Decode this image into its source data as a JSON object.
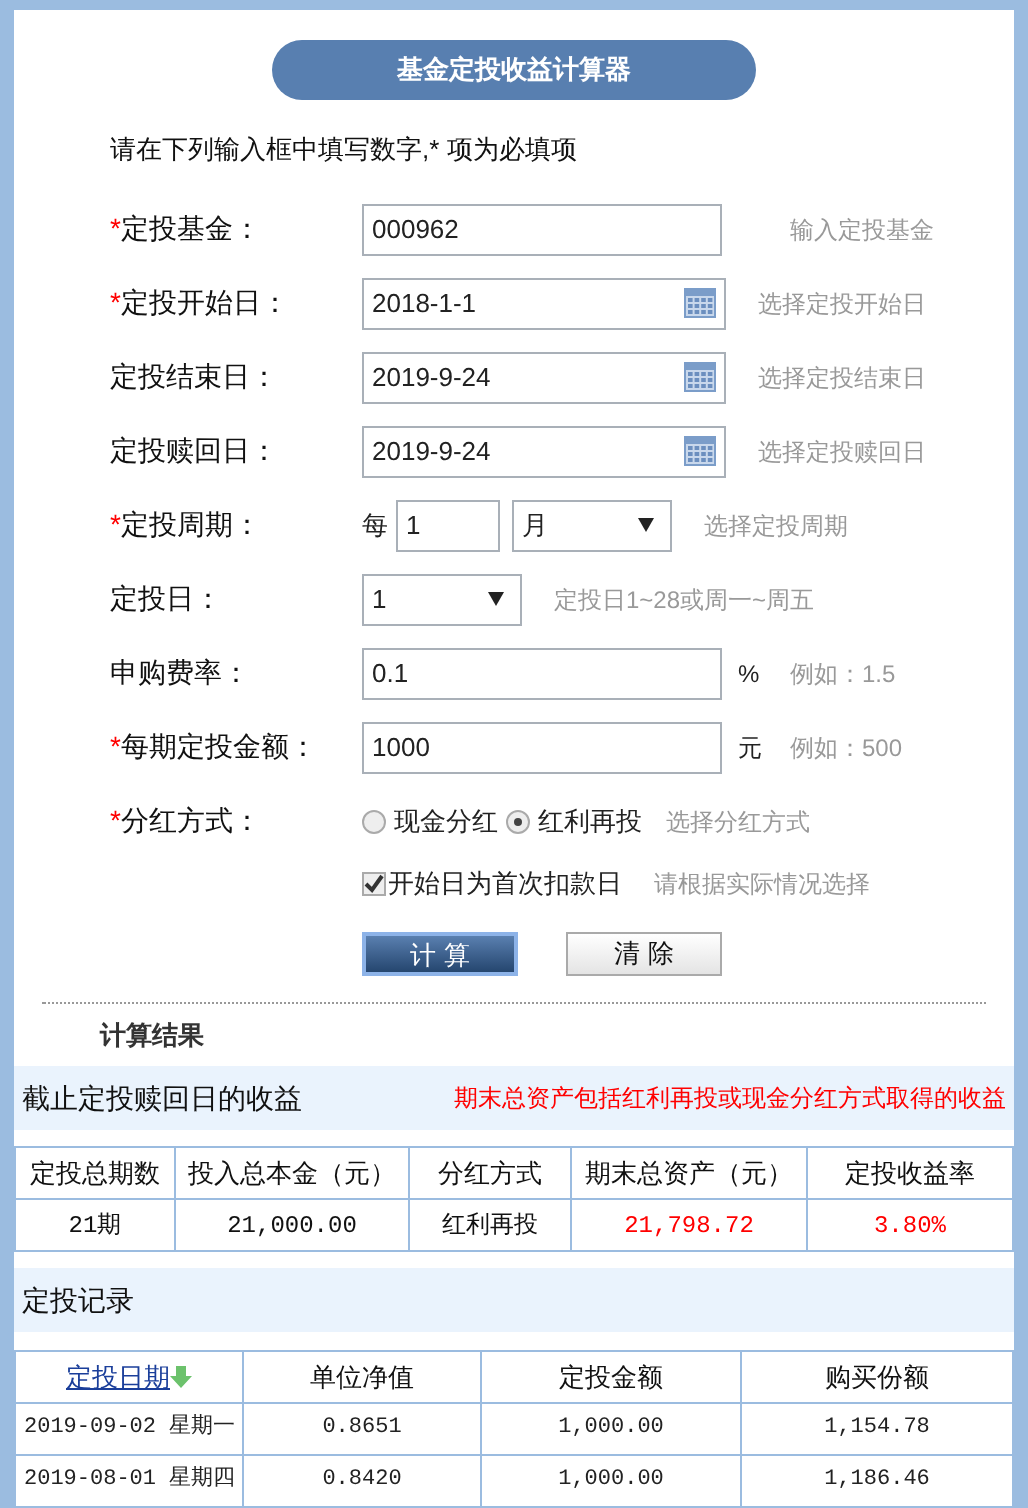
{
  "title": "基金定投收益计算器",
  "instruction": "请在下列输入框中填写数字,* 项为必填项",
  "form": [
    {
      "kind": "text",
      "required_mark": "*",
      "label": "定投基金：",
      "value": "000962",
      "hint": "输入定投基金"
    },
    {
      "kind": "date",
      "required_mark": "*",
      "label": "定投开始日：",
      "value": "2018-1-1",
      "hint": "选择定投开始日"
    },
    {
      "kind": "date",
      "label": "定投结束日：",
      "value": "2019-9-24",
      "hint": "选择定投结束日"
    },
    {
      "kind": "date",
      "label": "定投赎回日：",
      "value": "2019-9-24",
      "hint": "选择定投赎回日"
    },
    {
      "kind": "period",
      "required_mark": "*",
      "label": "定投周期：",
      "prefix": "每",
      "value": "1",
      "unit": "月",
      "hint": "选择定投周期"
    },
    {
      "kind": "select",
      "label": "定投日：",
      "value": "1",
      "hint": "定投日1~28或周一~周五"
    },
    {
      "kind": "text",
      "label": "申购费率：",
      "value": "0.1",
      "suffix": "%",
      "hint": "例如：1.5"
    },
    {
      "kind": "text",
      "required_mark": "*",
      "label": "每期定投金额：",
      "value": "1000",
      "suffix": "元",
      "hint": "例如：500"
    },
    {
      "kind": "radio",
      "required_mark": "*",
      "label": "分红方式：",
      "options": [
        {
          "label": "现金分红",
          "selected": false
        },
        {
          "label": "红利再投",
          "selected": true
        }
      ],
      "hint": "选择分红方式"
    },
    {
      "kind": "checkbox",
      "label": "开始日为首次扣款日",
      "checked": true,
      "hint": "请根据实际情况选择"
    }
  ],
  "buttons": [
    {
      "label": "计 算",
      "kind": "primary"
    },
    {
      "label": "清 除",
      "kind": "secondary"
    }
  ],
  "results": {
    "heading": "计算结果",
    "title": "截止定投赎回日的收益",
    "note": "期末总资产包括红利再投或现金分红方式取得的收益",
    "columns": [
      "定投总期数",
      "投入总本金（元）",
      "分红方式",
      "期末总资产（元）",
      "定投收益率"
    ],
    "rows": [
      [
        {
          "text": "21期",
          "highlight": false
        },
        {
          "text": "21,000.00",
          "highlight": false
        },
        {
          "text": "红利再投",
          "highlight": false
        },
        {
          "text": "21,798.72",
          "highlight": true
        },
        {
          "text": "3.80%",
          "highlight": true
        }
      ]
    ]
  },
  "records": {
    "title": "定投记录",
    "columns": [
      {
        "label": "定投日期",
        "sortable": true
      },
      {
        "label": "单位净值",
        "sortable": false
      },
      {
        "label": "定投金额",
        "sortable": false
      },
      {
        "label": "购买份额",
        "sortable": false
      }
    ],
    "rows": [
      [
        "2019-09-02 星期一",
        "0.8651",
        "1,000.00",
        "1,154.78"
      ],
      [
        "2019-08-01 星期四",
        "0.8420",
        "1,000.00",
        "1,186.46"
      ]
    ]
  }
}
